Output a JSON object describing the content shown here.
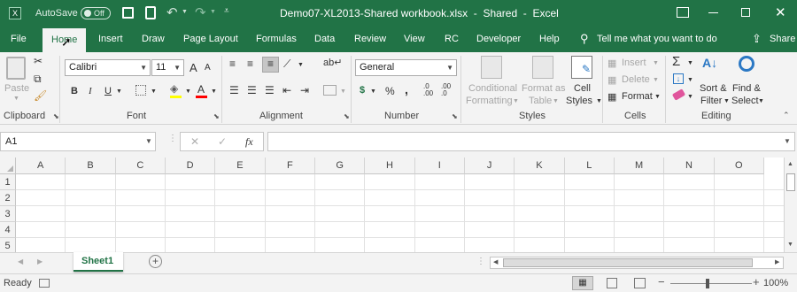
{
  "titlebar": {
    "autosave_label": "AutoSave",
    "autosave_state": "Off",
    "title": "Demo07-XL2013-Shared workbook.xlsx  -  Shared  -  Excel"
  },
  "tabs": [
    "File",
    "Home",
    "Insert",
    "Draw",
    "Page Layout",
    "Formulas",
    "Data",
    "Review",
    "View",
    "RC",
    "Developer",
    "Help"
  ],
  "active_tab": "Home",
  "tell_me": "Tell me what you want to do",
  "share": "Share",
  "ribbon": {
    "clipboard": {
      "paste": "Paste",
      "label": "Clipboard"
    },
    "font": {
      "name": "Calibri",
      "size": "11",
      "label": "Font",
      "bold": "B",
      "italic": "I",
      "underline": "U",
      "grow": "A",
      "shrink": "A",
      "font_color": "A"
    },
    "alignment": {
      "label": "Alignment"
    },
    "number": {
      "format": "General",
      "label": "Number",
      "currency": "$",
      "percent": "%",
      "comma": ",",
      "inc_dec": ".0 .00",
      "dec_dec": ".00 .0"
    },
    "styles": {
      "conditional_1": "Conditional",
      "conditional_2": "Formatting",
      "format_table_1": "Format as",
      "format_table_2": "Table",
      "cell_styles_1": "Cell",
      "cell_styles_2": "Styles",
      "label": "Styles"
    },
    "cells": {
      "insert": "Insert",
      "delete": "Delete",
      "format": "Format",
      "label": "Cells"
    },
    "editing": {
      "sort_1": "Sort &",
      "sort_2": "Filter",
      "find_1": "Find &",
      "find_2": "Select",
      "label": "Editing"
    }
  },
  "formula_bar": {
    "name_box": "A1",
    "fx": "fx",
    "cancel": "✕",
    "enter": "✓",
    "content": ""
  },
  "columns": [
    "A",
    "B",
    "C",
    "D",
    "E",
    "F",
    "G",
    "H",
    "I",
    "J",
    "K",
    "L",
    "M",
    "N",
    "O"
  ],
  "rows": [
    "1",
    "2",
    "3",
    "4",
    "5"
  ],
  "sheet_tabs": [
    "Sheet1"
  ],
  "status": {
    "ready": "Ready",
    "zoom": "100%"
  },
  "colors": {
    "brand": "#217346",
    "ribbon_bg": "#f3f3f3"
  }
}
